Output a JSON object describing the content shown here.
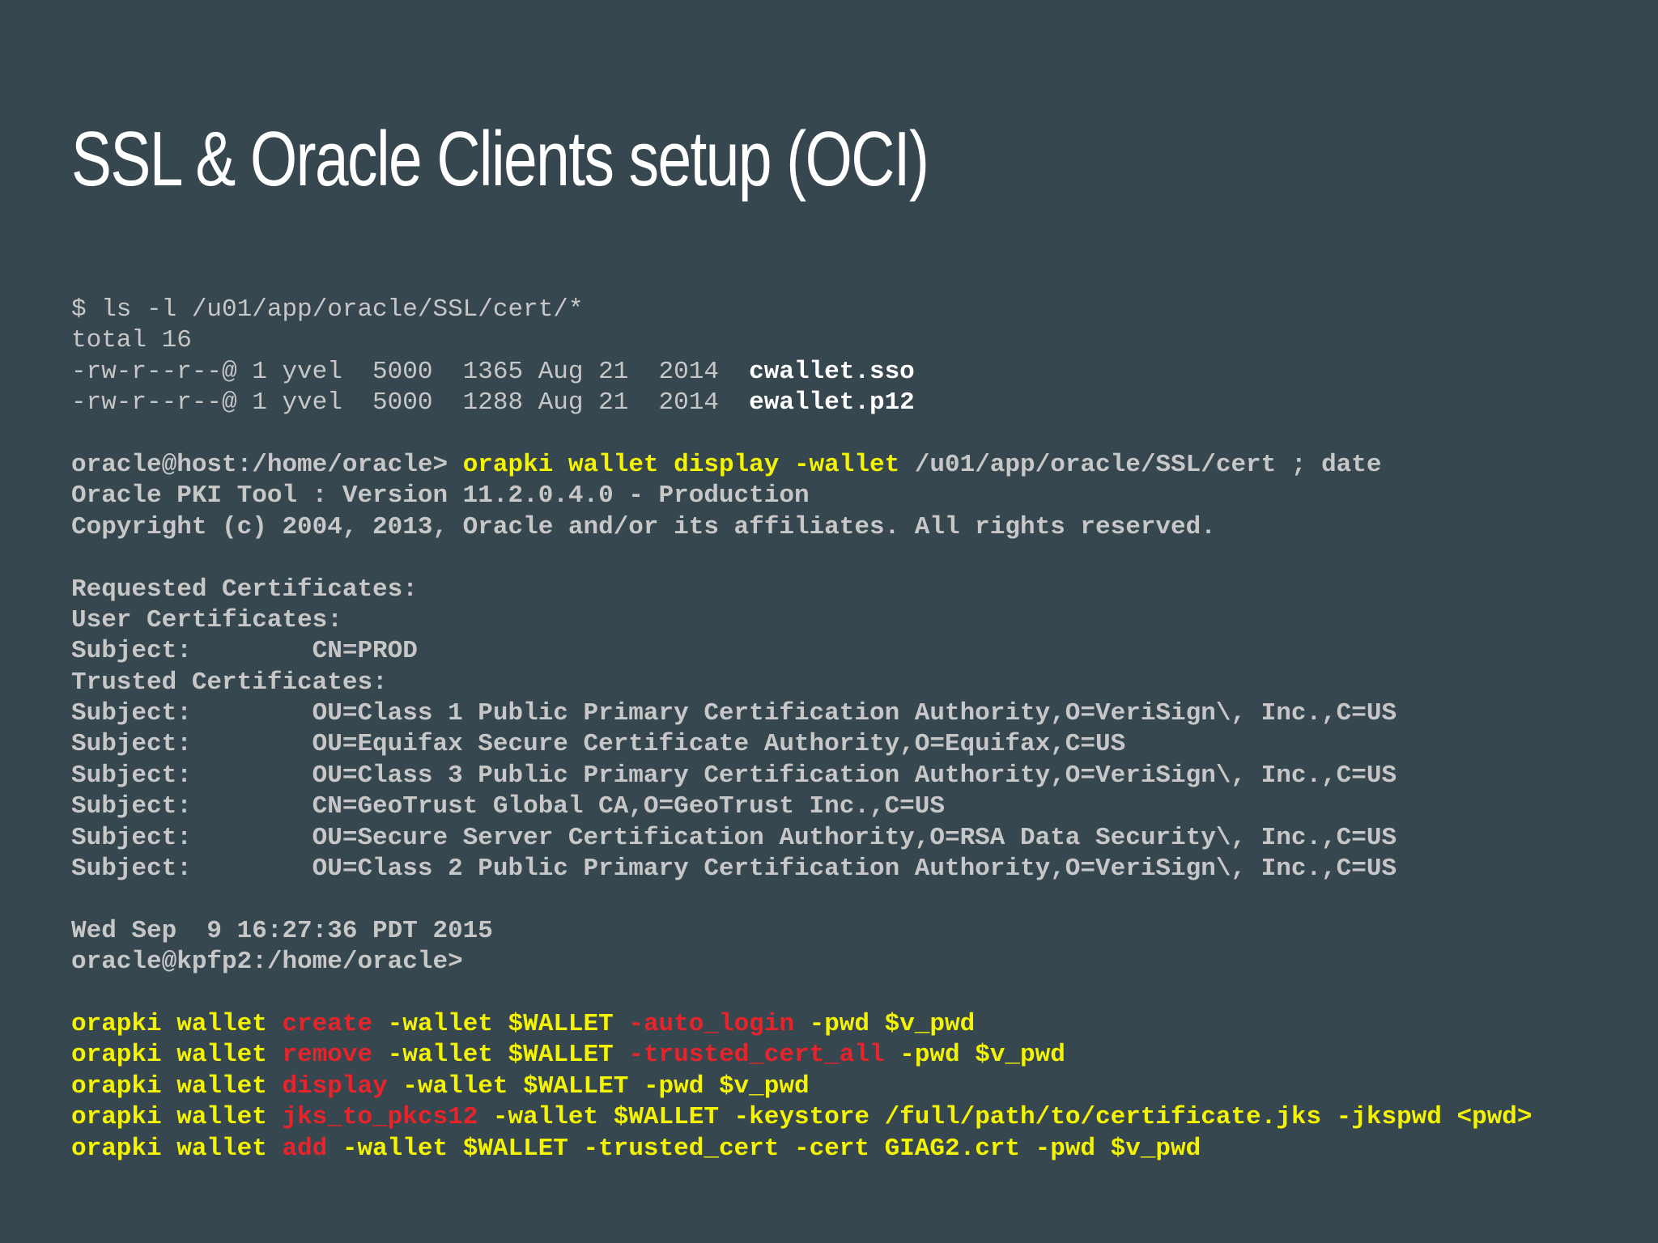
{
  "slide": {
    "title": "SSL & Oracle Clients setup  (OCI)"
  },
  "terminal": {
    "lines": [
      {
        "name": "ls-command-line",
        "segments": [
          {
            "text": "$ ls -l /u01/app/oracle/SSL/cert/*",
            "style": "gray"
          }
        ]
      },
      {
        "name": "ls-total-line",
        "segments": [
          {
            "text": "total 16",
            "style": "gray"
          }
        ]
      },
      {
        "name": "cwallet-file-line",
        "segments": [
          {
            "text": "-rw-r--r--@ 1 yvel  5000  1365 Aug 21  2014  ",
            "style": "gray"
          },
          {
            "text": "cwallet.sso",
            "style": "white-bold"
          }
        ]
      },
      {
        "name": "ewallet-file-line",
        "segments": [
          {
            "text": "-rw-r--r--@ 1 yvel  5000  1288 Aug 21  2014  ",
            "style": "gray"
          },
          {
            "text": "ewallet.p12",
            "style": "white-bold"
          }
        ]
      },
      {
        "name": "blank-line",
        "segments": []
      },
      {
        "name": "orapki-display-command-line",
        "segments": [
          {
            "text": "oracle@host:/home/oracle> ",
            "style": "gray-bold"
          },
          {
            "text": "orapki wallet display -wallet",
            "style": "yellow-bold"
          },
          {
            "text": " /u01/app/oracle/SSL/cert ; date",
            "style": "gray-bold"
          }
        ]
      },
      {
        "name": "pki-tool-version-line",
        "segments": [
          {
            "text": "Oracle PKI Tool : Version 11.2.0.4.0 - Production",
            "style": "gray-bold"
          }
        ]
      },
      {
        "name": "copyright-line",
        "segments": [
          {
            "text": "Copyright (c) 2004, 2013, Oracle and/or its affiliates. All rights reserved.",
            "style": "gray-bold"
          }
        ]
      },
      {
        "name": "blank-line",
        "segments": []
      },
      {
        "name": "requested-certificates-line",
        "segments": [
          {
            "text": "Requested Certificates:",
            "style": "gray-bold"
          }
        ]
      },
      {
        "name": "user-certificates-line",
        "segments": [
          {
            "text": "User Certificates:",
            "style": "gray-bold"
          }
        ]
      },
      {
        "name": "subject-line",
        "segments": [
          {
            "text": "Subject:        CN=PROD",
            "style": "gray-bold"
          }
        ]
      },
      {
        "name": "trusted-certificates-line",
        "segments": [
          {
            "text": "Trusted Certificates:",
            "style": "gray-bold"
          }
        ]
      },
      {
        "name": "subject-line",
        "segments": [
          {
            "text": "Subject:        OU=Class 1 Public Primary Certification Authority,O=VeriSign\\, Inc.,C=US",
            "style": "gray-bold"
          }
        ]
      },
      {
        "name": "subject-line",
        "segments": [
          {
            "text": "Subject:        OU=Equifax Secure Certificate Authority,O=Equifax,C=US",
            "style": "gray-bold"
          }
        ]
      },
      {
        "name": "subject-line",
        "segments": [
          {
            "text": "Subject:        OU=Class 3 Public Primary Certification Authority,O=VeriSign\\, Inc.,C=US",
            "style": "gray-bold"
          }
        ]
      },
      {
        "name": "subject-line",
        "segments": [
          {
            "text": "Subject:        CN=GeoTrust Global CA,O=GeoTrust Inc.,C=US",
            "style": "gray-bold"
          }
        ]
      },
      {
        "name": "subject-line",
        "segments": [
          {
            "text": "Subject:        OU=Secure Server Certification Authority,O=RSA Data Security\\, Inc.,C=US",
            "style": "gray-bold"
          }
        ]
      },
      {
        "name": "subject-line",
        "segments": [
          {
            "text": "Subject:        OU=Class 2 Public Primary Certification Authority,O=VeriSign\\, Inc.,C=US",
            "style": "gray-bold"
          }
        ]
      },
      {
        "name": "blank-line",
        "segments": []
      },
      {
        "name": "date-output-line",
        "segments": [
          {
            "text": "Wed Sep  9 16:27:36 PDT 2015",
            "style": "gray-bold"
          }
        ]
      },
      {
        "name": "prompt-line",
        "segments": [
          {
            "text": "oracle@kpfp2:/home/oracle>",
            "style": "gray-bold"
          }
        ]
      },
      {
        "name": "blank-line",
        "segments": []
      },
      {
        "name": "orapki-create-line",
        "segments": [
          {
            "text": "orapki wallet ",
            "style": "yellow-bold"
          },
          {
            "text": "create",
            "style": "red-bold"
          },
          {
            "text": " -wallet $WALLET ",
            "style": "yellow-bold"
          },
          {
            "text": "-auto_login",
            "style": "red-bold"
          },
          {
            "text": " -pwd $v_pwd",
            "style": "yellow-bold"
          }
        ]
      },
      {
        "name": "orapki-remove-line",
        "segments": [
          {
            "text": "orapki wallet ",
            "style": "yellow-bold"
          },
          {
            "text": "remove",
            "style": "red-bold"
          },
          {
            "text": " -wallet $WALLET ",
            "style": "yellow-bold"
          },
          {
            "text": "-trusted_cert_all",
            "style": "red-bold"
          },
          {
            "text": " -pwd $v_pwd",
            "style": "yellow-bold"
          }
        ]
      },
      {
        "name": "orapki-display-line",
        "segments": [
          {
            "text": "orapki wallet ",
            "style": "yellow-bold"
          },
          {
            "text": "display",
            "style": "red-bold"
          },
          {
            "text": " -wallet $WALLET -pwd $v_pwd",
            "style": "yellow-bold"
          }
        ]
      },
      {
        "name": "orapki-jks-to-pkcs12-line",
        "segments": [
          {
            "text": "orapki wallet ",
            "style": "yellow-bold"
          },
          {
            "text": "jks_to_pkcs12",
            "style": "red-bold"
          },
          {
            "text": " -wallet $WALLET -keystore /full/path/to/certificate.jks -jkspwd <pwd>",
            "style": "yellow-bold"
          }
        ]
      },
      {
        "name": "orapki-add-line",
        "segments": [
          {
            "text": "orapki wallet ",
            "style": "yellow-bold"
          },
          {
            "text": "add",
            "style": "red-bold"
          },
          {
            "text": " -wallet $WALLET -trusted_cert -cert GIAG2.crt -pwd $v_pwd",
            "style": "yellow-bold"
          }
        ]
      }
    ]
  },
  "colors": {
    "background": "#37474f",
    "title": "#ffffff",
    "text_gray": "#c7c7c7",
    "text_white": "#ffffff",
    "command_yellow": "#f4f400",
    "keyword_red": "#e8232a"
  }
}
